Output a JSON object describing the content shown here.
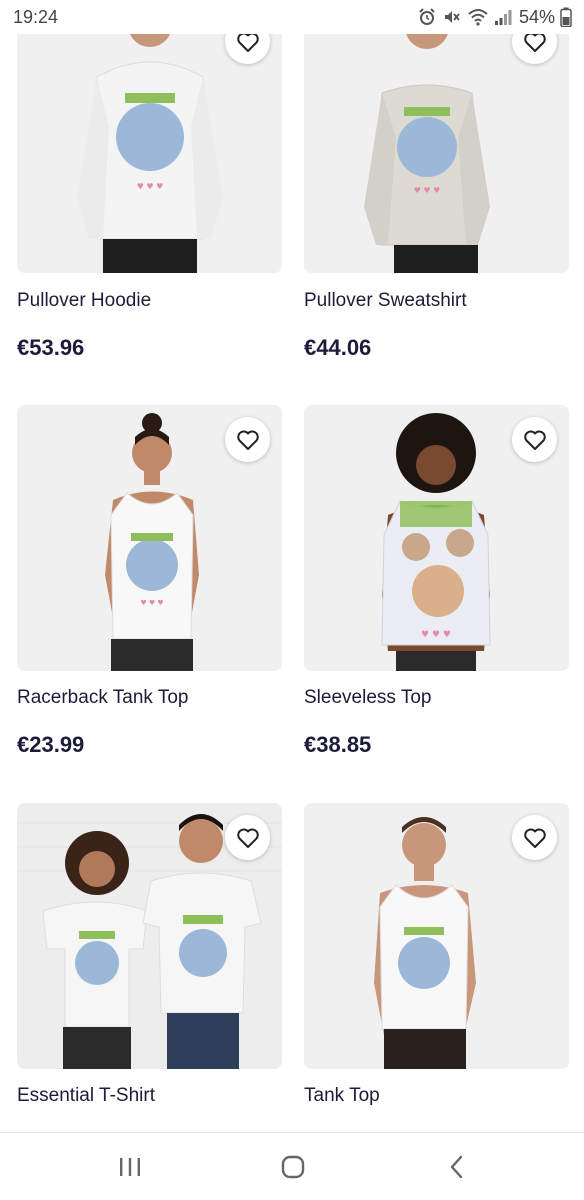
{
  "status_bar": {
    "time": "19:24",
    "battery": "54%"
  },
  "products": [
    {
      "title": "Pullover Hoodie",
      "price": "€53.96"
    },
    {
      "title": "Pullover Sweatshirt",
      "price": "€44.06"
    },
    {
      "title": "Racerback Tank Top",
      "price": "€23.99"
    },
    {
      "title": "Sleeveless Top",
      "price": "€38.85"
    },
    {
      "title": "Essential T-Shirt",
      "price": ""
    },
    {
      "title": "Tank Top",
      "price": ""
    }
  ],
  "colors": {
    "text": "#1c1c3a",
    "card_bg": "#f0f0f0",
    "accent_pink": "#e58aa8",
    "accent_green": "#8fbf5a"
  },
  "icons": {
    "favorite": "heart-outline-icon",
    "nav_recents": "recent-apps-icon",
    "nav_home": "home-icon",
    "nav_back": "back-icon"
  }
}
